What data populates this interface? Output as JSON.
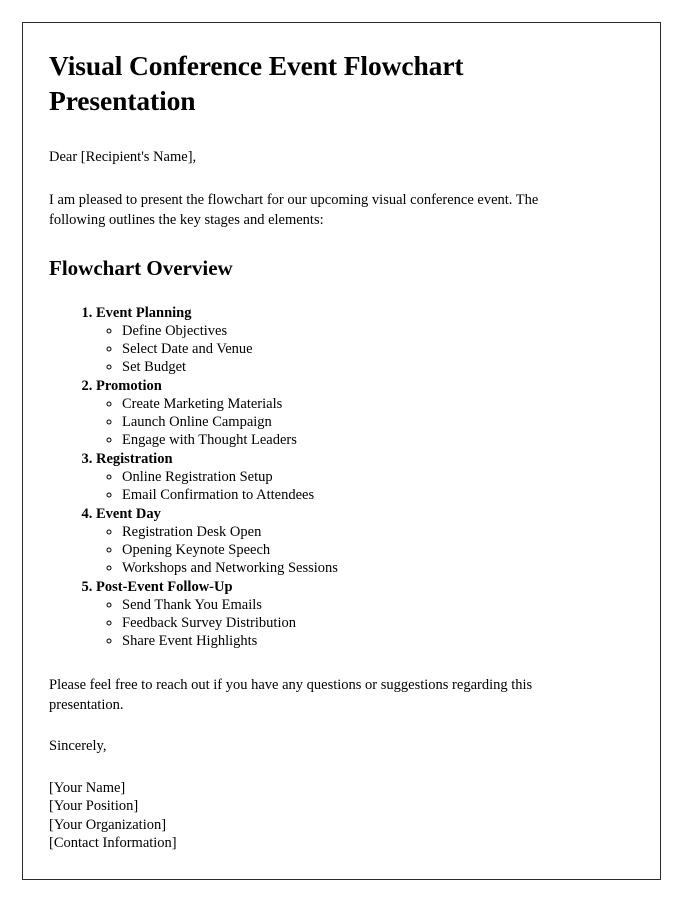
{
  "document": {
    "title": "Visual Conference Event Flowchart Presentation",
    "salutation": "Dear [Recipient's Name],",
    "intro_paragraph": "I am pleased to present the flowchart for our upcoming visual conference event. The following outlines the key stages and elements:",
    "section_heading": "Flowchart Overview",
    "stages": [
      {
        "number": "1",
        "label": "Event Planning",
        "substeps": [
          "Define Objectives",
          "Select Date and Venue",
          "Set Budget"
        ]
      },
      {
        "number": "2",
        "label": "Promotion",
        "substeps": [
          "Create Marketing Materials",
          "Launch Online Campaign",
          "Engage with Thought Leaders"
        ]
      },
      {
        "number": "3",
        "label": "Registration",
        "substeps": [
          "Online Registration Setup",
          "Email Confirmation to Attendees"
        ]
      },
      {
        "number": "4",
        "label": "Event Day",
        "substeps": [
          "Registration Desk Open",
          "Opening Keynote Speech",
          "Workshops and Networking Sessions"
        ]
      },
      {
        "number": "5",
        "label": "Post-Event Follow-Up",
        "substeps": [
          "Send Thank You Emails",
          "Feedback Survey Distribution",
          "Share Event Highlights"
        ]
      }
    ],
    "closing_paragraph": "Please feel free to reach out if you have any questions or suggestions regarding this presentation.",
    "signoff": "Sincerely,",
    "signature_lines": [
      "[Your Name]",
      "[Your Position]",
      "[Your Organization]",
      "[Contact Information]"
    ]
  }
}
